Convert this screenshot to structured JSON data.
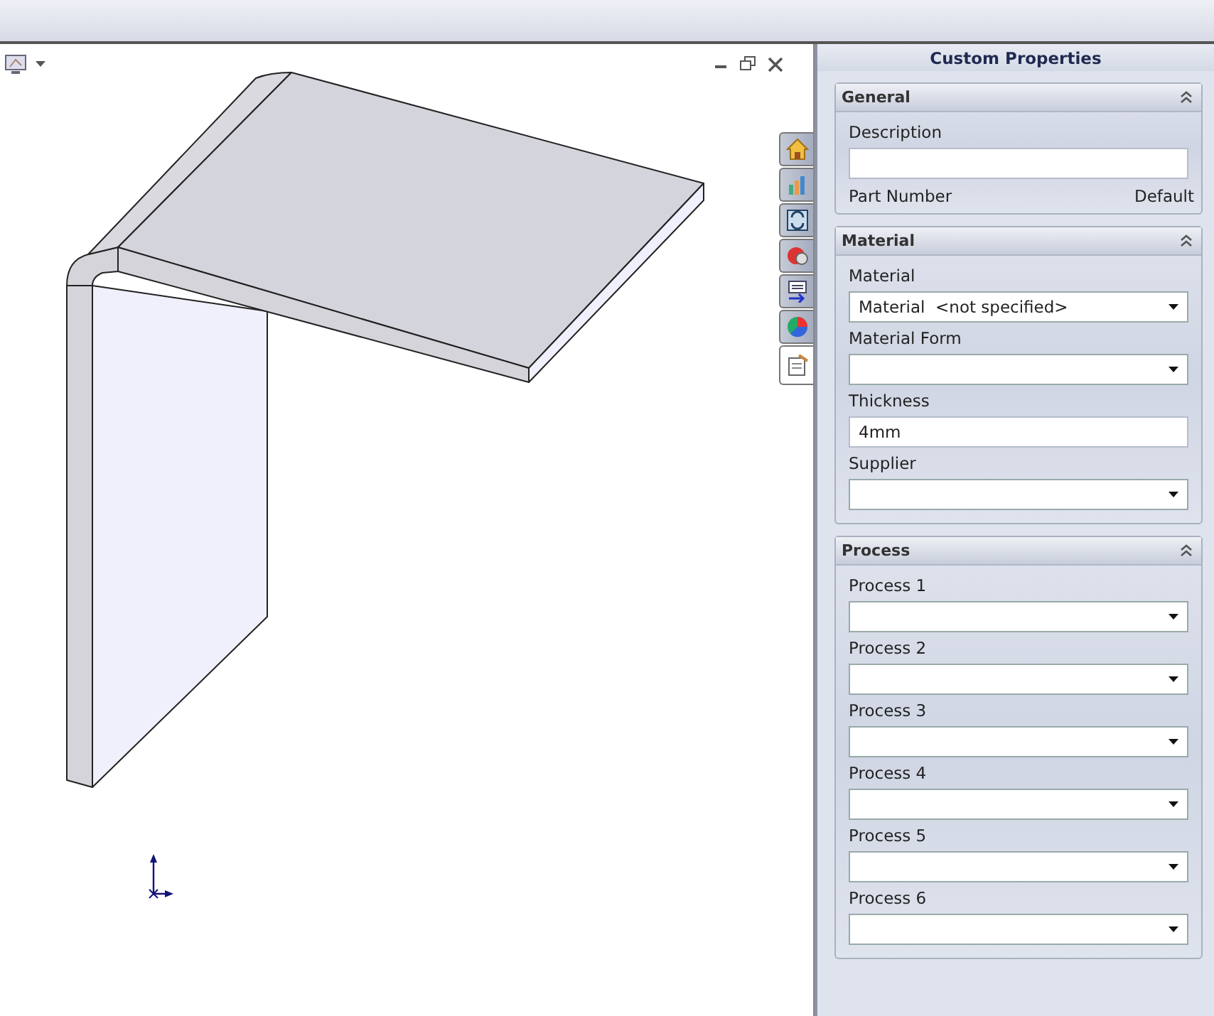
{
  "panel": {
    "title": "Custom Properties"
  },
  "tabs": [
    {
      "selected": false
    },
    {
      "selected": false
    },
    {
      "selected": false
    },
    {
      "selected": false
    },
    {
      "selected": false
    },
    {
      "selected": false
    },
    {
      "selected": true
    }
  ],
  "sections": [
    {
      "title": "General",
      "fields": [
        {
          "kind": "text",
          "label": "Description"
        },
        {
          "kind": "pair",
          "label": "Part Number",
          "value": "Default"
        }
      ]
    },
    {
      "title": "Material",
      "fields": [
        {
          "kind": "dropdown",
          "label": "Material",
          "value": "Material  <not specified>"
        },
        {
          "kind": "dropdown",
          "label": "Material Form"
        },
        {
          "kind": "text",
          "label": "Thickness",
          "value": "4mm"
        },
        {
          "kind": "dropdown",
          "label": "Supplier"
        }
      ]
    },
    {
      "title": "Process",
      "fields": [
        {
          "kind": "dropdown",
          "label": "Process 1"
        },
        {
          "kind": "dropdown",
          "label": "Process 2"
        },
        {
          "kind": "dropdown",
          "label": "Process 3"
        },
        {
          "kind": "dropdown",
          "label": "Process 4"
        },
        {
          "kind": "dropdown",
          "label": "Process 5"
        },
        {
          "kind": "dropdown",
          "label": "Process 6"
        }
      ]
    }
  ]
}
